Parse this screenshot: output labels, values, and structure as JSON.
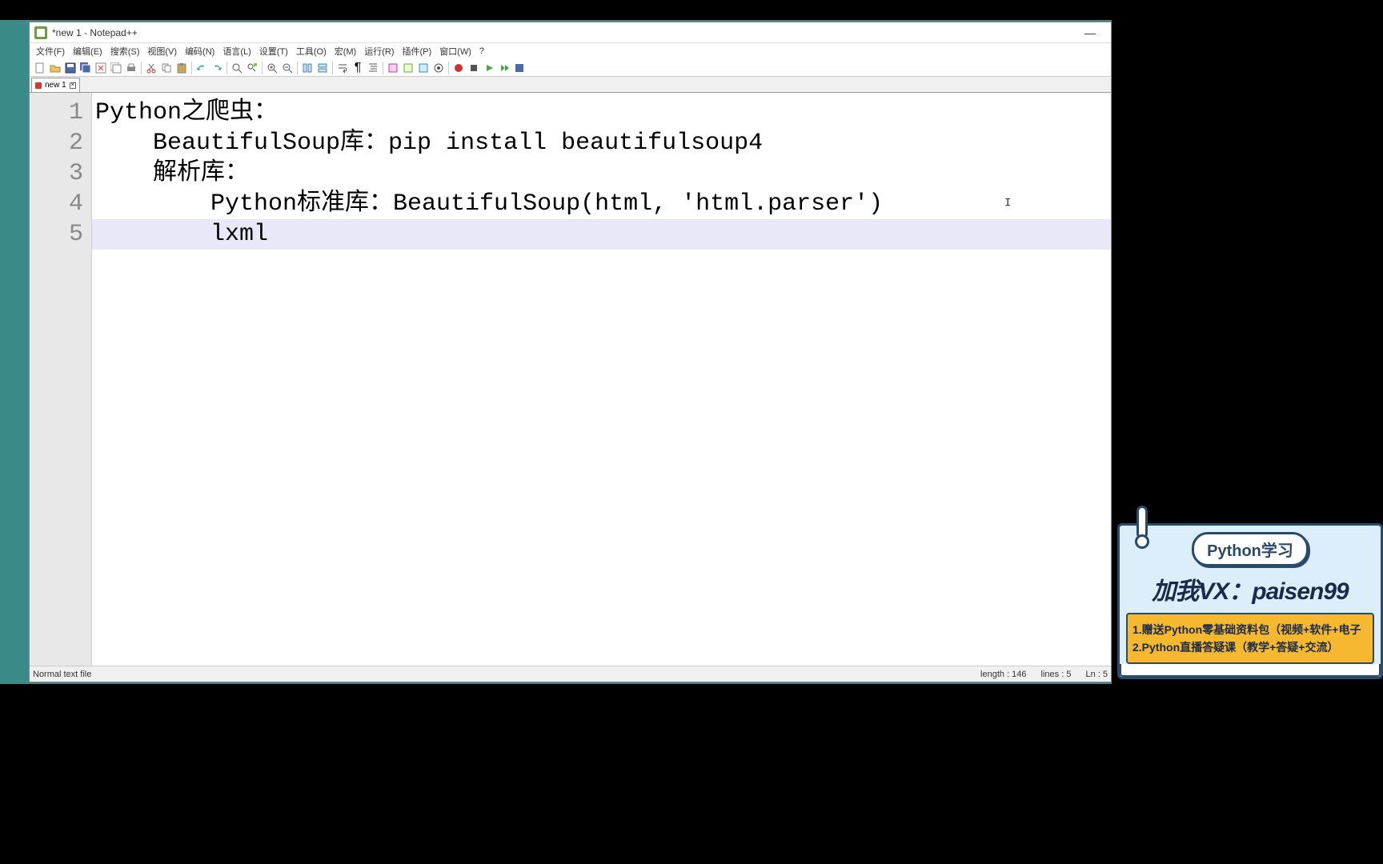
{
  "window": {
    "title": "*new 1 - Notepad++",
    "minimize": "—"
  },
  "menus": [
    "文件(F)",
    "编辑(E)",
    "搜索(S)",
    "视图(V)",
    "编码(N)",
    "语言(L)",
    "设置(T)",
    "工具(O)",
    "宏(M)",
    "运行(R)",
    "插件(P)",
    "窗口(W)",
    "?"
  ],
  "tab": {
    "label": "new 1"
  },
  "code": {
    "lines": [
      {
        "n": "1",
        "text": "Python之爬虫："
      },
      {
        "n": "2",
        "text": "    BeautifulSoup库：pip install beautifulsoup4"
      },
      {
        "n": "3",
        "text": "    解析库："
      },
      {
        "n": "4",
        "text": "        Python标准库：BeautifulSoup(html, 'html.parser')"
      },
      {
        "n": "5",
        "text": "        lxml"
      }
    ],
    "active_line": 5
  },
  "status": {
    "left": "Normal text file",
    "length_label": "length : 146",
    "lines_label": "lines : 5",
    "ln_label": "Ln : 5"
  },
  "overlay": {
    "badge": "Python学习",
    "vx": "加我VX：paisen99",
    "bullet1": "1.赠送Python零基础资料包（视频+软件+电子",
    "bullet2": "2.Python直播答疑课（教学+答疑+交流）"
  }
}
